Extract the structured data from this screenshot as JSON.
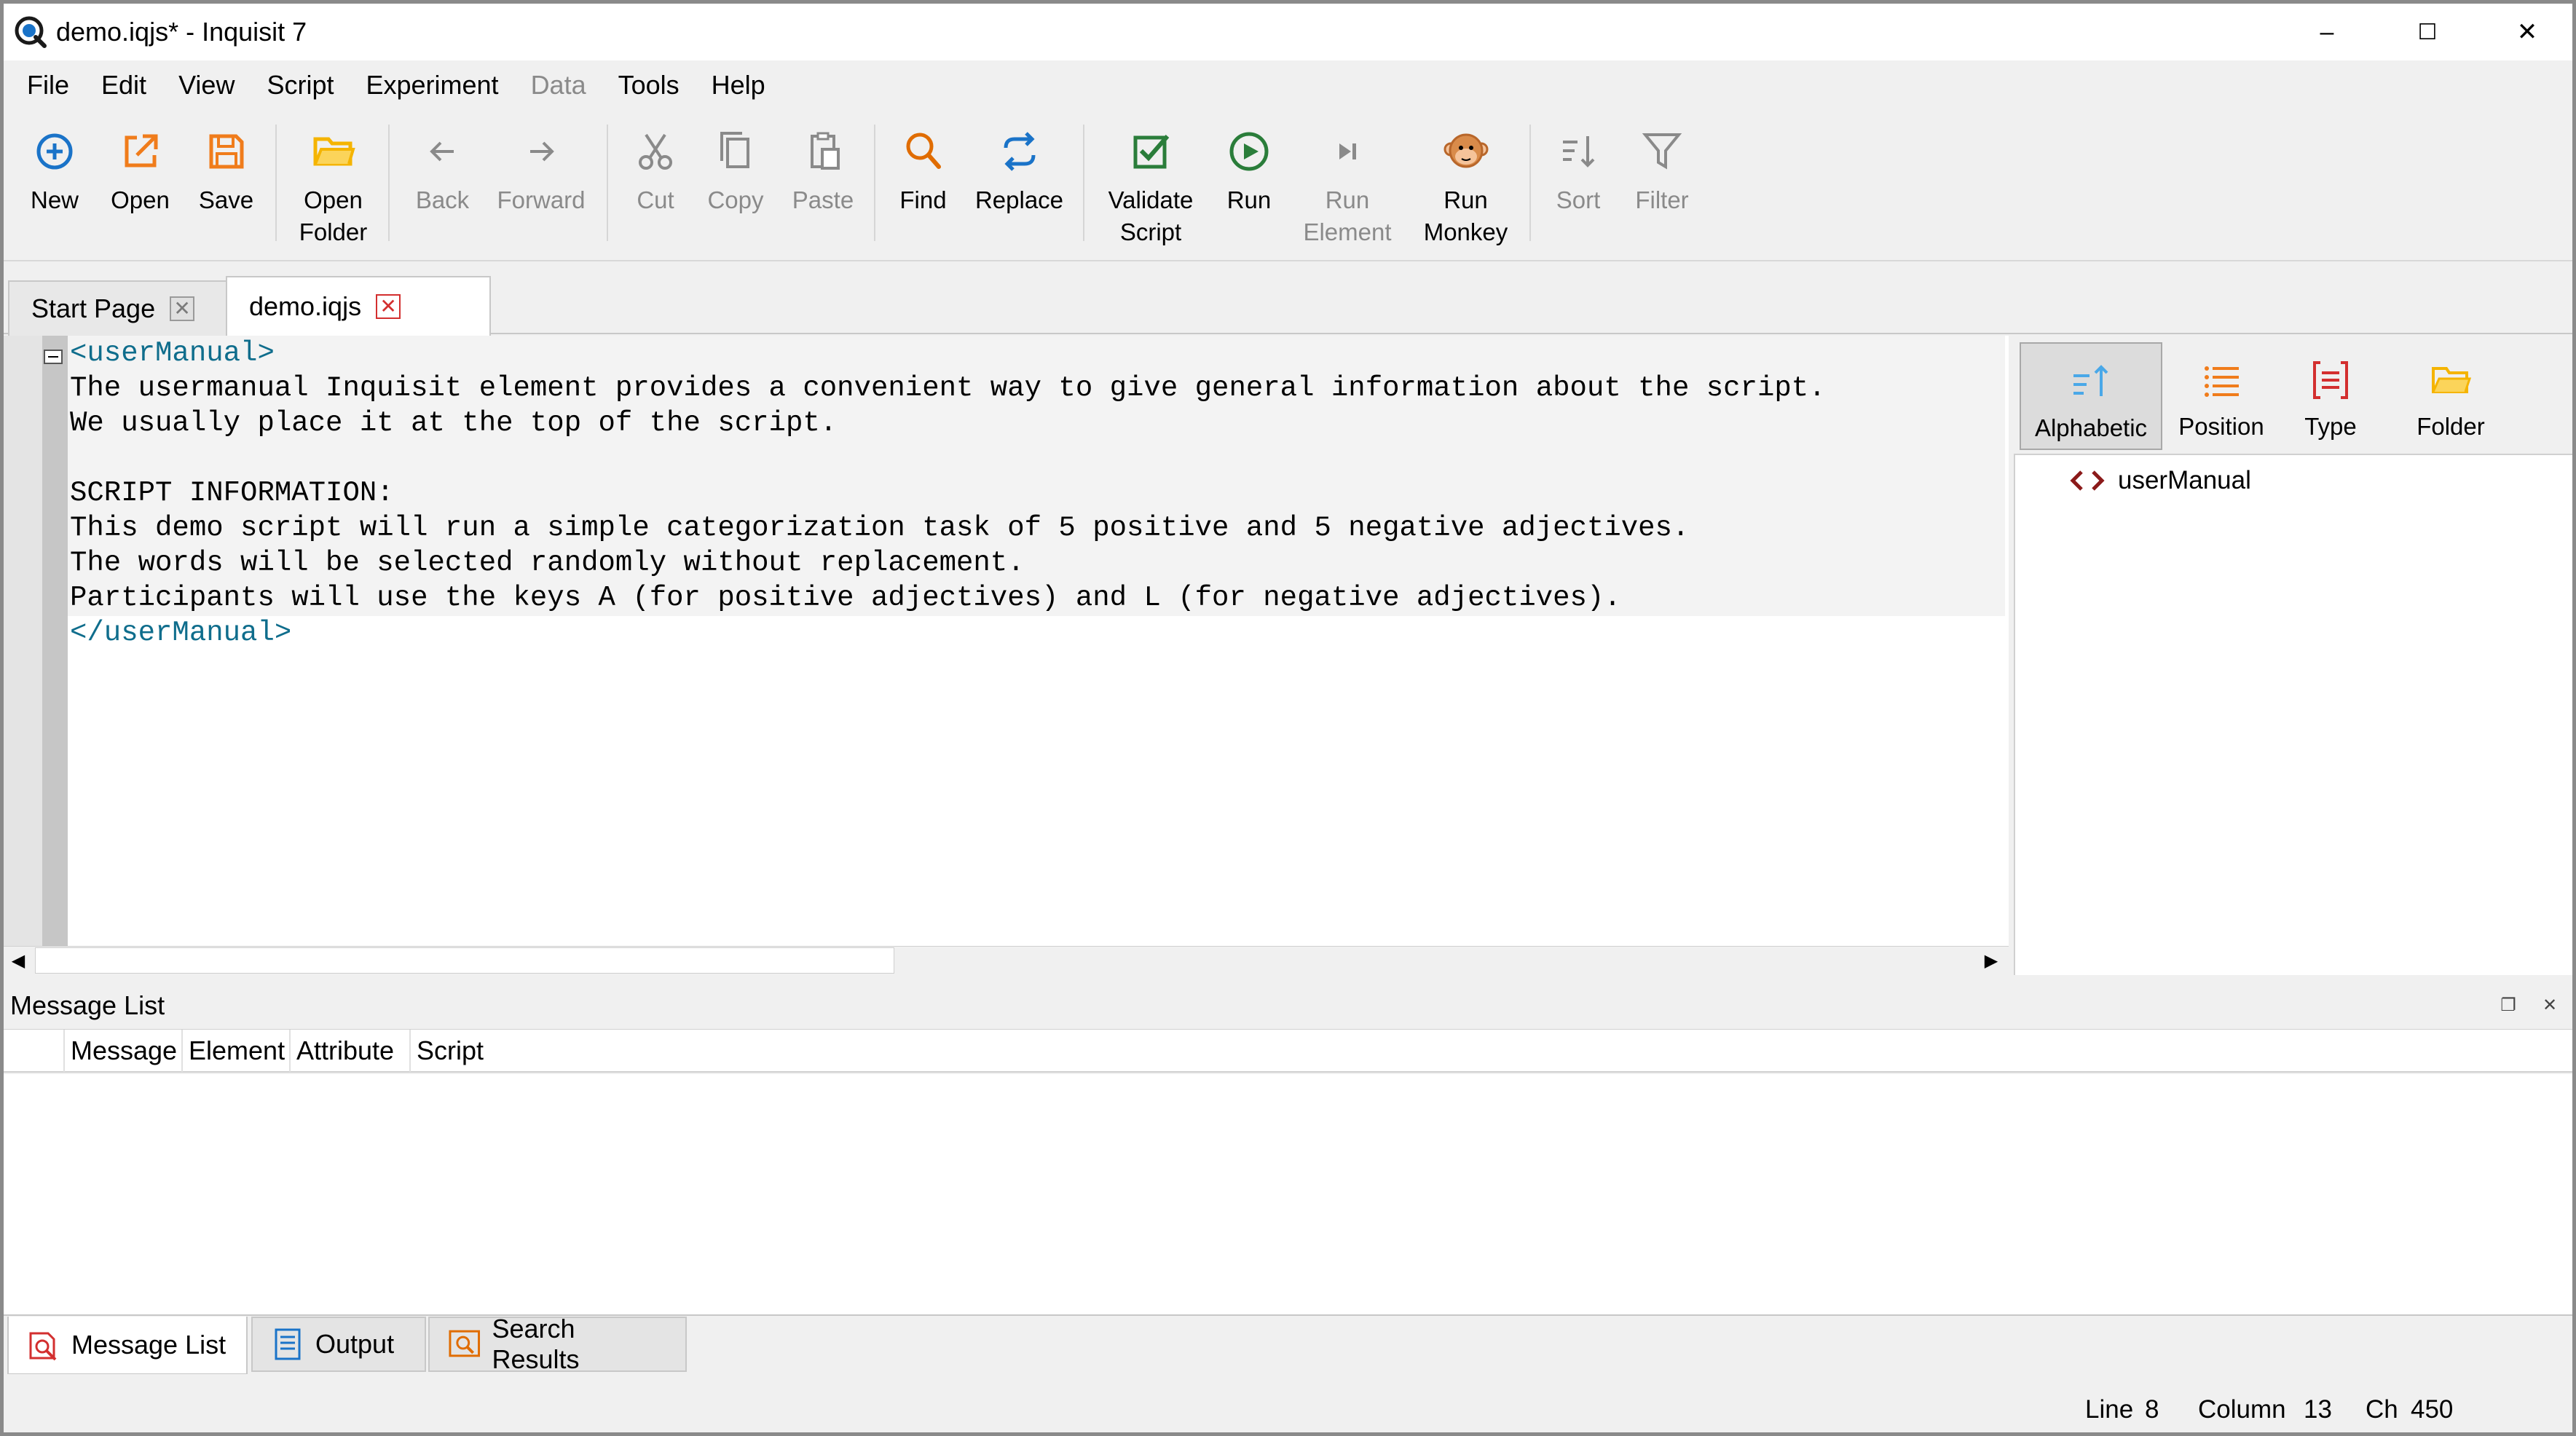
{
  "window": {
    "title": "demo.iqjs* - Inquisit 7",
    "controls": {
      "minimize": "–",
      "maximize": "☐",
      "close": "✕"
    }
  },
  "menu": [
    "File",
    "Edit",
    "View",
    "Script",
    "Experiment",
    "Data",
    "Tools",
    "Help"
  ],
  "toolbar": {
    "new": "New",
    "open": "Open",
    "save": "Save",
    "open_folder": "Open\nFolder",
    "back": "Back",
    "forward": "Forward",
    "cut": "Cut",
    "copy": "Copy",
    "paste": "Paste",
    "find": "Find",
    "replace": "Replace",
    "validate_script": "Validate\nScript",
    "run": "Run",
    "run_element": "Run\nElement",
    "run_monkey": "Run\nMonkey",
    "sort": "Sort",
    "filter": "Filter"
  },
  "tabs": [
    {
      "label": "Start Page"
    },
    {
      "label": "demo.iqjs"
    }
  ],
  "editor": {
    "lines": [
      "<userManual>",
      "The usermanual Inquisit element provides a convenient way to give general information about the script.",
      "We usually place it at the top of the script.",
      "",
      "SCRIPT INFORMATION:",
      "This demo script will run a simple categorization task of 5 positive and 5 negative adjectives.",
      "The words will be selected randomly without replacement.",
      "Participants will use the keys A (for positive adjectives) and L (for negative adjectives).",
      "</userManual>"
    ]
  },
  "element_panel": {
    "buttons": {
      "alphabetic": "Alphabetic",
      "position": "Position",
      "type": "Type",
      "folder": "Folder"
    },
    "tree": [
      {
        "label": "userManual"
      }
    ]
  },
  "message_list": {
    "title": "Message List",
    "columns": [
      "Message",
      "Element",
      "Attribute",
      "Script"
    ]
  },
  "bottom_tabs": [
    {
      "label": "Message List"
    },
    {
      "label": "Output"
    },
    {
      "label": "Search Results"
    }
  ],
  "status": {
    "line_label": "Line",
    "line": "8",
    "column_label": "Column",
    "column": "13",
    "ch_label": "Ch",
    "ch": "450"
  },
  "colors": {
    "accent_blue": "#1a73c8",
    "accent_orange": "#f07c1b",
    "accent_green": "#2a7d3a",
    "accent_red": "#d32f2f",
    "tag_color": "#0f6d8c"
  }
}
